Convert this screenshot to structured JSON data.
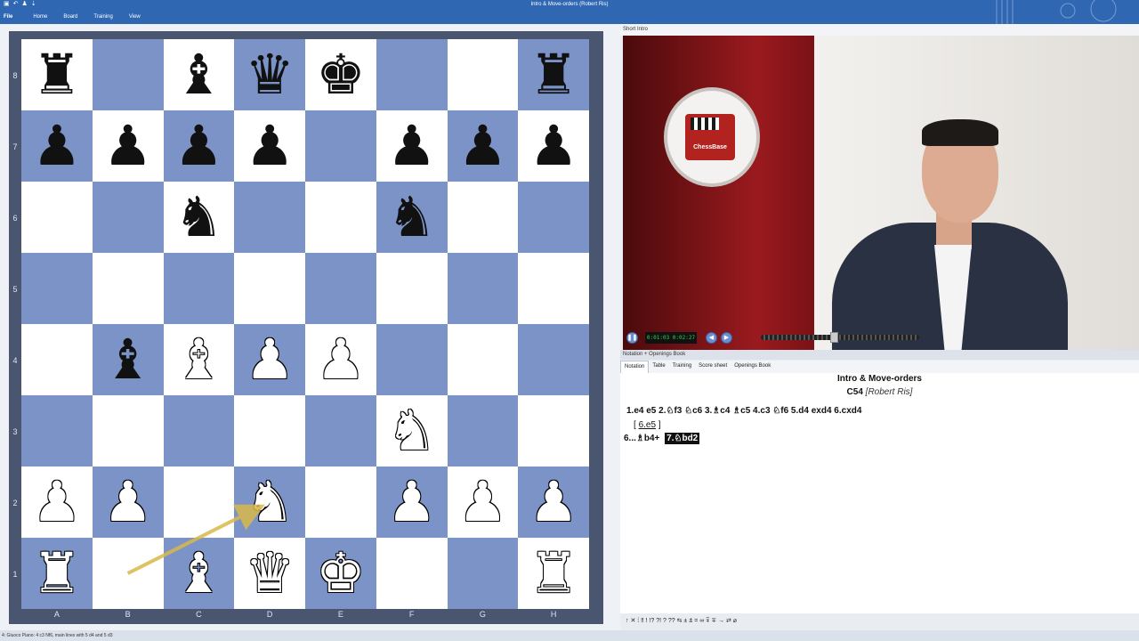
{
  "app": {
    "title": "Intro & Move-orders  (Robert Ris)",
    "menu": [
      "File",
      "Home",
      "Board",
      "Training",
      "View"
    ]
  },
  "board": {
    "ranks": [
      "8",
      "7",
      "6",
      "5",
      "4",
      "3",
      "2",
      "1"
    ],
    "files": [
      "A",
      "B",
      "C",
      "D",
      "E",
      "F",
      "G",
      "H"
    ],
    "position": [
      [
        "bR",
        "",
        "bB",
        "bQ",
        "bK",
        "",
        "",
        "bR"
      ],
      [
        "bP",
        "bP",
        "bP",
        "bP",
        "",
        "bP",
        "bP",
        "bP"
      ],
      [
        "",
        "",
        "bN",
        "",
        "",
        "bN",
        "",
        ""
      ],
      [
        "",
        "",
        "",
        "",
        "",
        "",
        "",
        ""
      ],
      [
        "",
        "bB",
        "wB",
        "wP",
        "wP",
        "",
        "",
        ""
      ],
      [
        "",
        "",
        "",
        "",
        "",
        "wN",
        "",
        ""
      ],
      [
        "wP",
        "wP",
        "",
        "wN",
        "",
        "wP",
        "wP",
        "wP"
      ],
      [
        "wR",
        "",
        "wB",
        "wQ",
        "wK",
        "",
        "",
        "wR"
      ]
    ],
    "arrow": {
      "from": "b1",
      "to": "d2",
      "color": "#d8b94a"
    },
    "colors": {
      "light": "#ffffff",
      "dark": "#7b93c6",
      "frame": "#4a5670"
    }
  },
  "video": {
    "panel_title": "Short Intro",
    "timecode": "0:01:03 0:02:27",
    "logo_text": "ChessBase"
  },
  "notation": {
    "panel_title": "Notation + Openings Book",
    "tabs": [
      "Notation",
      "Table",
      "Training",
      "Score sheet",
      "Openings Book"
    ],
    "game_title": "Intro & Move-orders",
    "eco": "C54",
    "author": "[Robert Ris]",
    "main_line": "1.e4  e5  2.♘f3  ♘c6  3.♗c4  ♗c5  4.c3  ♘f6  5.d4  exd4  6.cxd4",
    "variation_open": "[",
    "variation_move": "6.e5",
    "variation_close": "]",
    "line2_move": "6...♗b4+",
    "current_move": "7.♘bd2"
  },
  "annotation_bar": "↑ ✕ ⁞ ‼ ! !? ?! ? ?? ⇆ ± ⩲ = ∞ ⩱ ∓ → ⇄ ⌀",
  "status": "4: Giuoco Piano: 4 c3 Nf6, main lines with 5 d4 and 5 d3"
}
